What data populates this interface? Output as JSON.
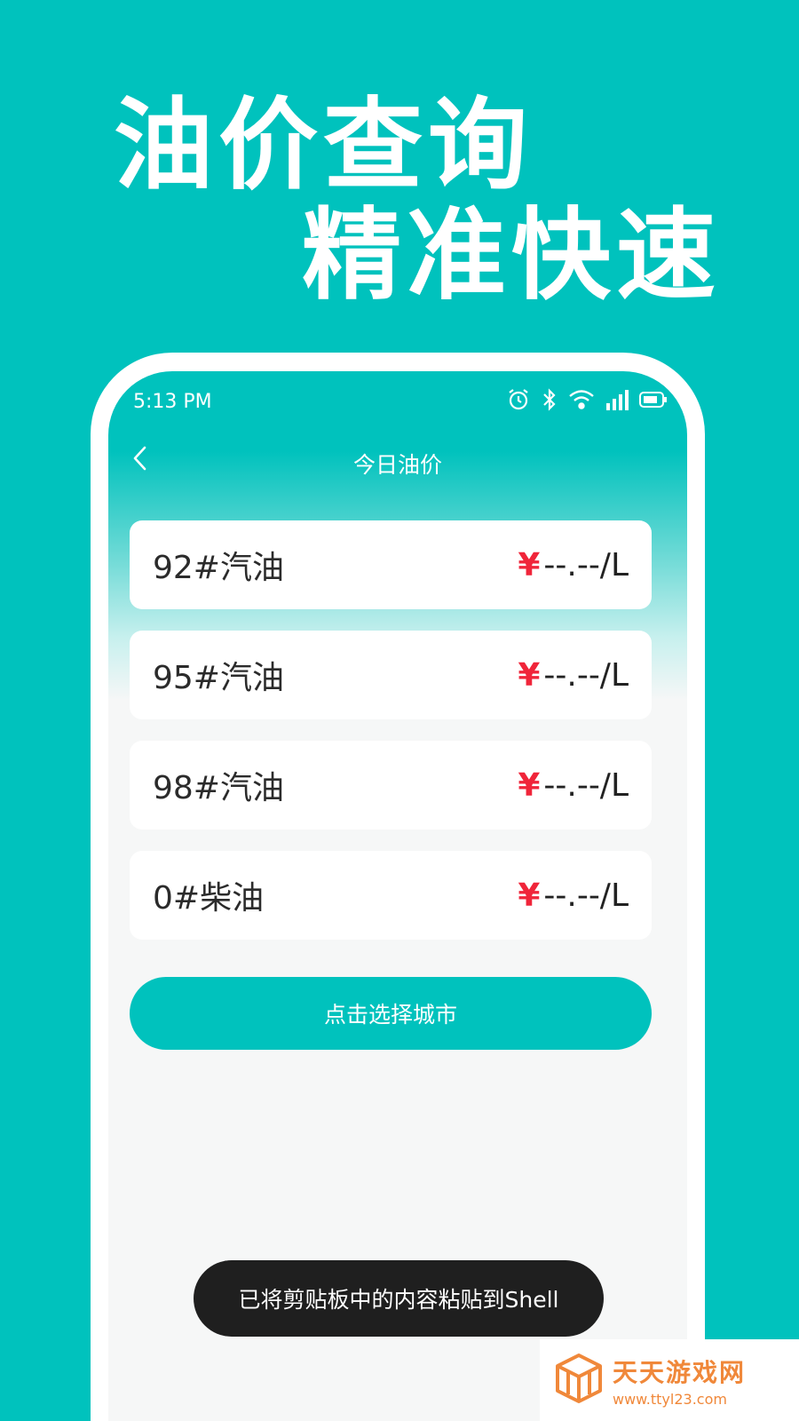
{
  "promo": {
    "line1": "油价查询",
    "line2": "精准快速"
  },
  "status_bar": {
    "time": "5:13 PM",
    "icons": [
      "alarm-icon",
      "bluetooth-icon",
      "wifi-icon",
      "signal-icon",
      "battery-icon"
    ]
  },
  "nav": {
    "title": "今日油价",
    "back_icon": "chevron-left-icon"
  },
  "prices": [
    {
      "name": "92#汽油",
      "currency": "¥",
      "value": "--.--/L"
    },
    {
      "name": "95#汽油",
      "currency": "¥",
      "value": "--.--/L"
    },
    {
      "name": "98#汽油",
      "currency": "¥",
      "value": "--.--/L"
    },
    {
      "name": "0#柴油",
      "currency": "¥",
      "value": "--.--/L"
    }
  ],
  "city_button": {
    "label": "点击选择城市"
  },
  "toast": {
    "message": "已将剪贴板中的内容粘贴到Shell"
  },
  "watermark": {
    "title": "天天游戏网",
    "url": "www.ttyl23.com"
  },
  "colors": {
    "brand": "#00C2BD",
    "price_currency": "#F0253A",
    "watermark": "#F0883A"
  }
}
